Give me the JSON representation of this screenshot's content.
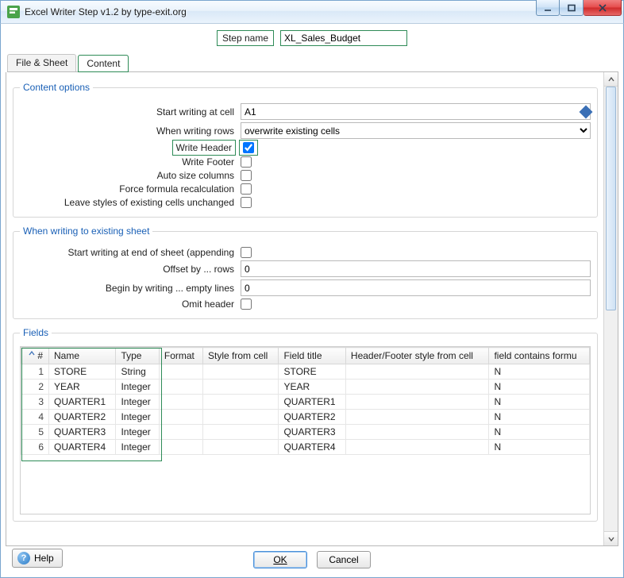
{
  "window": {
    "title": "Excel Writer Step v1.2 by type-exit.org"
  },
  "stepname": {
    "label": "Step name",
    "value": "XL_Sales_Budget"
  },
  "tabs": {
    "file": "File & Sheet",
    "content": "Content"
  },
  "content_options": {
    "legend": "Content options",
    "start_cell_label": "Start writing at cell",
    "start_cell_value": "A1",
    "when_rows_label": "When writing rows",
    "when_rows_value": "overwrite existing cells",
    "write_header_label": "Write Header",
    "write_footer_label": "Write Footer",
    "autosize_label": "Auto size columns",
    "force_recalc_label": "Force formula recalculation",
    "leave_styles_label": "Leave styles of existing cells unchanged"
  },
  "existing_sheet": {
    "legend": "When writing to existing sheet",
    "append_label": "Start writing at end of sheet (appending",
    "offset_label": "Offset by ... rows",
    "offset_value": "0",
    "empty_lines_label": "Begin by writing ... empty lines",
    "empty_lines_value": "0",
    "omit_header_label": "Omit header"
  },
  "fields": {
    "legend": "Fields",
    "columns": {
      "num": "#",
      "name": "Name",
      "type": "Type",
      "format": "Format",
      "style_from": "Style from cell",
      "field_title": "Field title",
      "hf_style": "Header/Footer style from cell",
      "contains_formula": "field contains formu"
    },
    "rows": [
      {
        "num": "1",
        "name": "STORE",
        "type": "String",
        "format": "",
        "style_from": "",
        "field_title": "STORE",
        "hf_style": "",
        "contains_formula": "N"
      },
      {
        "num": "2",
        "name": "YEAR",
        "type": "Integer",
        "format": "",
        "style_from": "",
        "field_title": "YEAR",
        "hf_style": "",
        "contains_formula": "N"
      },
      {
        "num": "3",
        "name": "QUARTER1",
        "type": "Integer",
        "format": "",
        "style_from": "",
        "field_title": "QUARTER1",
        "hf_style": "",
        "contains_formula": "N"
      },
      {
        "num": "4",
        "name": "QUARTER2",
        "type": "Integer",
        "format": "",
        "style_from": "",
        "field_title": "QUARTER2",
        "hf_style": "",
        "contains_formula": "N"
      },
      {
        "num": "5",
        "name": "QUARTER3",
        "type": "Integer",
        "format": "",
        "style_from": "",
        "field_title": "QUARTER3",
        "hf_style": "",
        "contains_formula": "N"
      },
      {
        "num": "6",
        "name": "QUARTER4",
        "type": "Integer",
        "format": "",
        "style_from": "",
        "field_title": "QUARTER4",
        "hf_style": "",
        "contains_formula": "N"
      }
    ]
  },
  "buttons": {
    "ok": "OK",
    "cancel": "Cancel",
    "help": "Help"
  }
}
